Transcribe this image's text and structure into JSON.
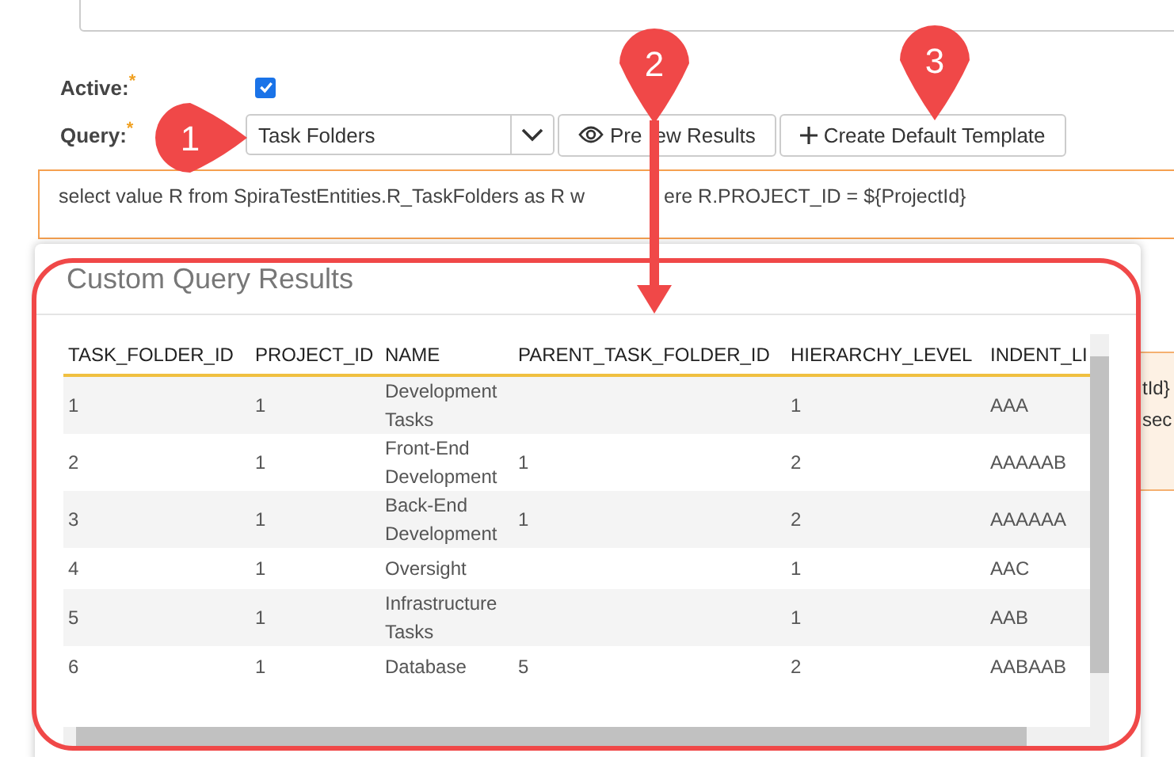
{
  "form": {
    "active": {
      "label": "Active:",
      "required_mark": "*",
      "checked": true
    },
    "query": {
      "label": "Query:",
      "required_mark": "*",
      "value": "Task Folders"
    },
    "buttons": [
      {
        "label_parts": [
          "Pre",
          "ew Results"
        ]
      },
      {
        "label_parts": [
          "Create Default Template"
        ]
      }
    ],
    "query_text_parts": [
      "select value R from SpiraTestEntities.R_TaskFolders as R w",
      "ere R.PROJECT_ID = ${ProjectId}"
    ]
  },
  "side_notice": {
    "lines": [
      "tId}",
      "sec"
    ]
  },
  "dialog": {
    "title": "Custom Query Results",
    "table": {
      "columns": [
        "TASK_FOLDER_ID",
        "PROJECT_ID",
        "NAME",
        "PARENT_TASK_FOLDER_ID",
        "HIERARCHY_LEVEL",
        "INDENT_LI"
      ],
      "rows": [
        [
          "1",
          "1",
          "Development Tasks",
          "",
          "1",
          "AAA"
        ],
        [
          "2",
          "1",
          "Front-End Development",
          "1",
          "2",
          "AAAAAB"
        ],
        [
          "3",
          "1",
          "Back-End Development",
          "1",
          "2",
          "AAAAAA"
        ],
        [
          "4",
          "1",
          "Oversight",
          "",
          "1",
          "AAC"
        ],
        [
          "5",
          "1",
          "Infrastructure Tasks",
          "",
          "1",
          "AAB"
        ],
        [
          "6",
          "1",
          "Database",
          "5",
          "2",
          "AABAAB"
        ]
      ]
    }
  },
  "callouts": [
    {
      "number": "1",
      "kind": "right"
    },
    {
      "number": "2",
      "kind": "down-arrow"
    },
    {
      "number": "3",
      "kind": "down"
    }
  ]
}
